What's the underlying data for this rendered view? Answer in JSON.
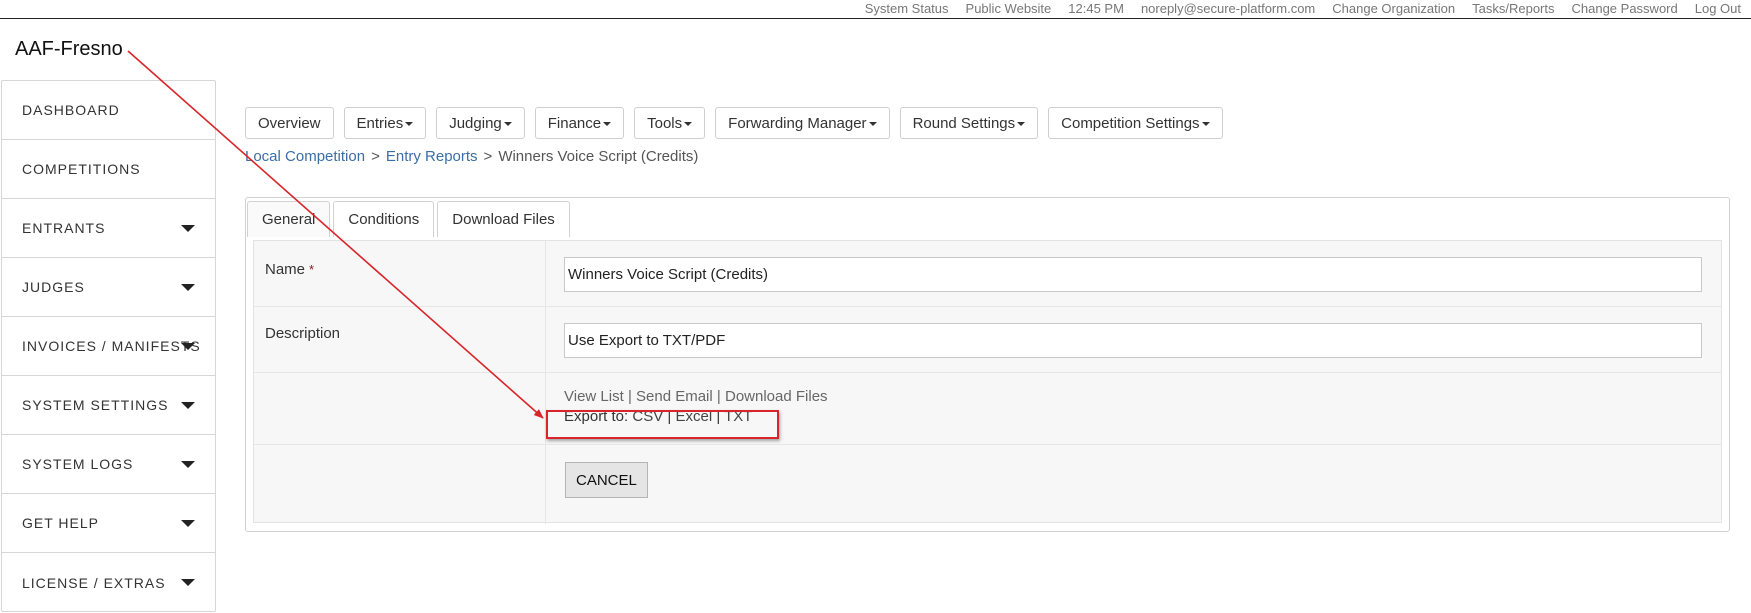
{
  "topbar": {
    "links": [
      "System Status",
      "Public Website",
      "12:45 PM",
      "noreply@secure-platform.com",
      "Change Organization",
      "Tasks/Reports",
      "Change Password",
      "Log Out"
    ]
  },
  "org_title": "AAF-Fresno",
  "sidebar": {
    "items": [
      {
        "label": "DASHBOARD",
        "has_caret": false
      },
      {
        "label": "COMPETITIONS",
        "has_caret": false
      },
      {
        "label": "ENTRANTS",
        "has_caret": true
      },
      {
        "label": "JUDGES",
        "has_caret": true
      },
      {
        "label": "INVOICES / MANIFESTS",
        "has_caret": true
      },
      {
        "label": "SYSTEM SETTINGS",
        "has_caret": true
      },
      {
        "label": "SYSTEM LOGS",
        "has_caret": true
      },
      {
        "label": "GET HELP",
        "has_caret": true
      },
      {
        "label": "LICENSE / EXTRAS",
        "has_caret": true
      }
    ]
  },
  "nav": {
    "buttons": [
      {
        "label": "Overview",
        "dropdown": false
      },
      {
        "label": "Entries",
        "dropdown": true
      },
      {
        "label": "Judging",
        "dropdown": true
      },
      {
        "label": "Finance",
        "dropdown": true
      },
      {
        "label": "Tools",
        "dropdown": true
      },
      {
        "label": "Forwarding Manager",
        "dropdown": true
      },
      {
        "label": "Round Settings",
        "dropdown": true
      },
      {
        "label": "Competition Settings",
        "dropdown": true
      }
    ]
  },
  "breadcrumb": {
    "items": [
      "Local Competition",
      "Entry Reports",
      "Winners Voice Script (Credits)"
    ],
    "separator": ">"
  },
  "tabs": [
    "General",
    "Conditions",
    "Download Files"
  ],
  "form": {
    "name_label": "Name",
    "required_mark": "*",
    "name_value": "Winners Voice Script (Credits)",
    "description_label": "Description",
    "description_value": "Use Export to TXT/PDF",
    "action_links": [
      "View List",
      "Send Email",
      "Download Files"
    ],
    "export_prefix": "Export to:",
    "export_links": [
      "CSV",
      "Excel",
      "TXT"
    ],
    "link_separator": "|",
    "cancel_label": "CANCEL"
  },
  "colors": {
    "annotation_red": "#d9252a",
    "link_blue": "#3b6ea5"
  }
}
